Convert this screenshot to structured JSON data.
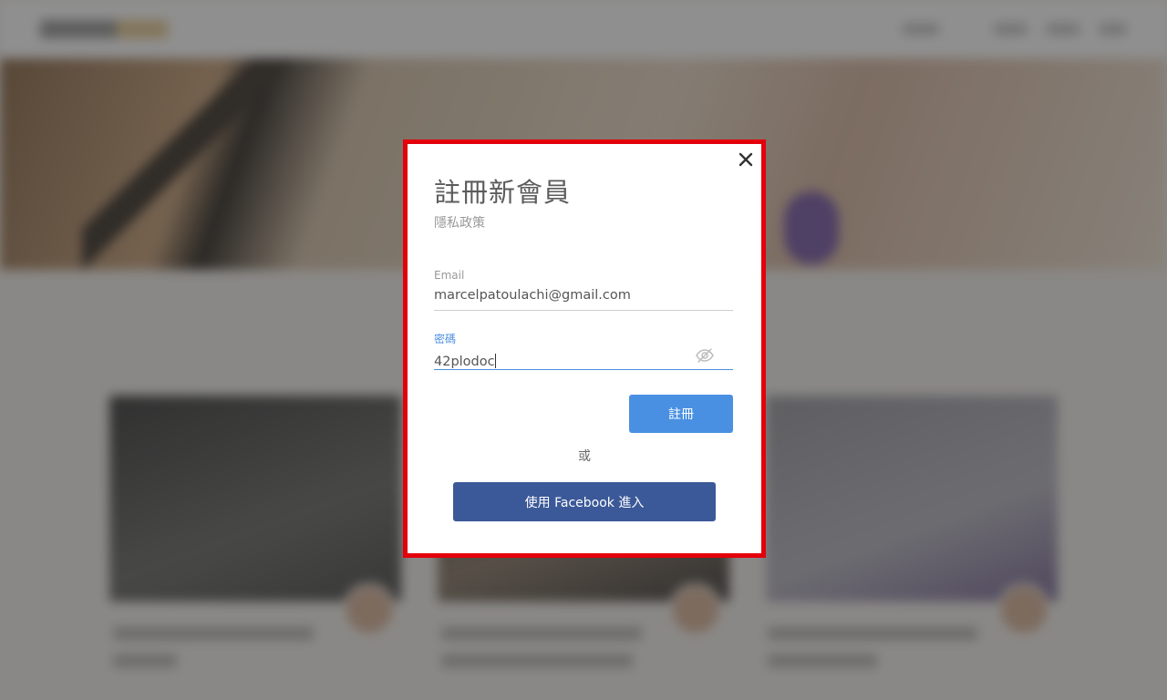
{
  "modal": {
    "title": "註冊新會員",
    "privacy_link": "隱私政策",
    "email": {
      "label": "Email",
      "value": "marcelpatoulachi@gmail.com"
    },
    "password": {
      "label": "密碼",
      "value": "42plodoc"
    },
    "register_button": "註冊",
    "or_text": "或",
    "facebook_button": "使用 Facebook 進入"
  },
  "colors": {
    "accent": "#4a90e2",
    "facebook": "#3b5998",
    "highlight_border": "#e3000b"
  },
  "icons": {
    "close": "close-icon",
    "password_toggle": "eye-slash-icon"
  }
}
